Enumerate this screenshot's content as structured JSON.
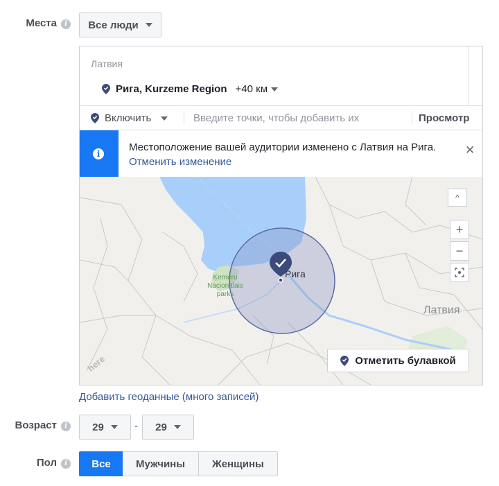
{
  "places": {
    "label": "Места",
    "audience_dropdown": "Все люди",
    "country_header": "Латвия",
    "selected_location": "Рига, Kurzeme Region",
    "radius": "+40 км",
    "include_dropdown": "Включить",
    "search_placeholder": "Введите точки, чтобы добавить их",
    "browse_label": "Просмотр",
    "notice": {
      "text": "Местоположение вашей аудитории изменено с Латвия на Рига.",
      "undo_link": "Отменить изменение"
    },
    "map": {
      "city_label": "Рига",
      "country_label": "Латвия",
      "park_label": "Ķemeru Nacionālais parks",
      "watermark": "here",
      "drop_pin_button": "Отметить булавкой",
      "zoom_in": "+",
      "zoom_out": "−",
      "collapse": "^"
    },
    "bulk_link": "Добавить геоданные (много записей)"
  },
  "age": {
    "label": "Возраст",
    "min": "29",
    "separator": "-",
    "max": "29"
  },
  "gender": {
    "label": "Пол",
    "options": [
      "Все",
      "Мужчины",
      "Женщины"
    ],
    "selected": "Все"
  },
  "colors": {
    "accent": "#1877f2",
    "link": "#365899",
    "water": "#a8cff9",
    "pin": "#3b4b7b",
    "radius_fill": "#8a93c2"
  }
}
